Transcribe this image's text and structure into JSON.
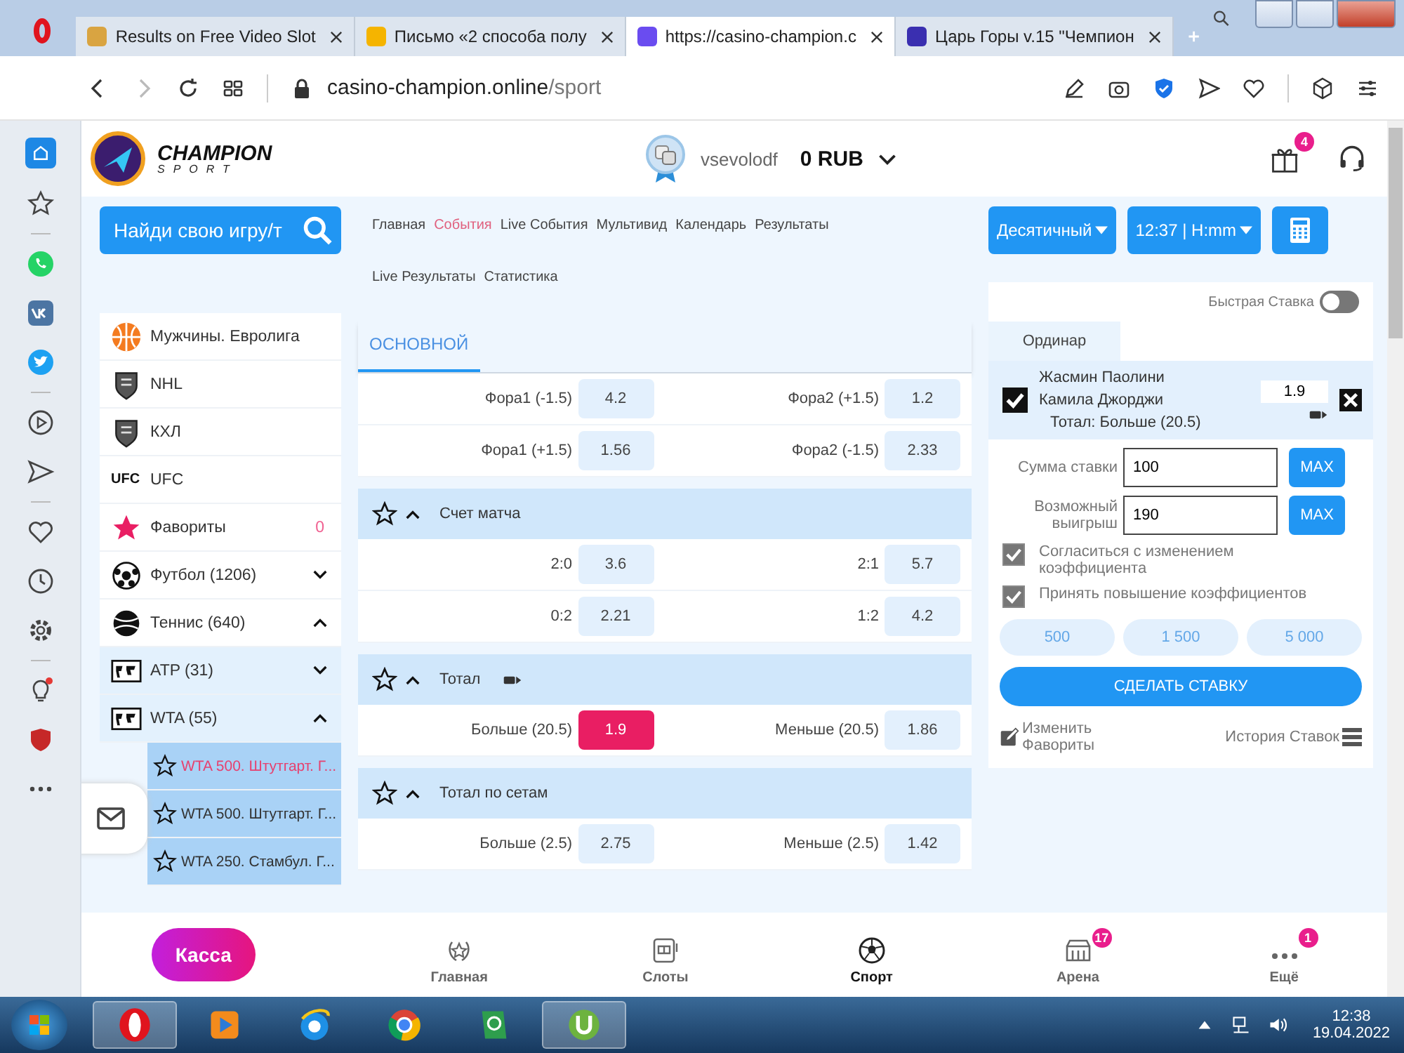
{
  "browser": {
    "tabs": [
      {
        "title": "Results on Free Video Slot",
        "selected": false
      },
      {
        "title": "Письмо «2 способа полу",
        "selected": false
      },
      {
        "title": "https://casino-champion.c",
        "selected": true
      },
      {
        "title": "Царь Горы v.15 \"Чемпион",
        "selected": false
      }
    ],
    "url": {
      "host": "casino-champion.online",
      "path": "/sport"
    }
  },
  "header": {
    "logo": {
      "title": "CHAMPION",
      "subtitle": "SPORT"
    },
    "user": {
      "name": "vsevolodf",
      "balance": "0 RUB"
    },
    "gift_badge": "4"
  },
  "search": {
    "label": "Найди свою игру/т"
  },
  "nav_links": [
    {
      "label": "Главная",
      "selected": false
    },
    {
      "label": "События",
      "selected": true
    },
    {
      "label": "Live События",
      "selected": false
    },
    {
      "label": "Мультивид",
      "selected": false
    },
    {
      "label": "Календарь",
      "selected": false
    },
    {
      "label": "Результаты",
      "selected": false
    },
    {
      "label": "Live Результаты",
      "selected": false
    },
    {
      "label": "Статистика",
      "selected": false
    }
  ],
  "settings": {
    "odds_format": "Десятичный",
    "time_format": "12:37 | H:mm"
  },
  "sidebar": {
    "items": [
      {
        "label": "Мужчины. Евролига",
        "kind": "basketball",
        "selected": false
      },
      {
        "label": "NHL",
        "kind": "shield",
        "selected": false
      },
      {
        "label": "КХЛ",
        "kind": "shield",
        "selected": false
      },
      {
        "label": "UFC",
        "kind": "text_logo",
        "logo_text": "UFC",
        "selected": false
      },
      {
        "label": "Фавориты",
        "kind": "favorites",
        "count": "0",
        "selected": false
      },
      {
        "label": "Футбол (1206)",
        "kind": "football",
        "expanded": false,
        "selected": false
      },
      {
        "label": "Теннис (640)",
        "kind": "tennis",
        "expanded": true,
        "selected": false,
        "children": [
          {
            "label": "ATP (31)",
            "kind": "map",
            "expanded": false,
            "selected": false
          },
          {
            "label": "WTA (55)",
            "kind": "map",
            "expanded": true,
            "selected": false,
            "children": [
              {
                "label": "WTA 500. Штутгарт. Г...",
                "kind": "star",
                "selected": true
              },
              {
                "label": "WTA 500. Штутгарт. Г...",
                "kind": "star",
                "selected": false
              },
              {
                "label": "WTA 250. Стамбул. Г...",
                "kind": "star",
                "selected": false
              }
            ]
          }
        ]
      }
    ]
  },
  "market_tabs": [
    {
      "label": "ОСНОВНОЙ",
      "selected": true
    }
  ],
  "markets": [
    {
      "rows": [
        {
          "outcomes": [
            {
              "label": "Фора1 (-1.5)",
              "odds": "4.2",
              "selected": false
            },
            {
              "label": "Фора2 (+1.5)",
              "odds": "1.2",
              "selected": false
            }
          ]
        },
        {
          "outcomes": [
            {
              "label": "Фора1 (+1.5)",
              "odds": "1.56",
              "selected": false
            },
            {
              "label": "Фора2 (-1.5)",
              "odds": "2.33",
              "selected": false
            }
          ]
        }
      ]
    },
    {
      "title": "Счет матча",
      "favorite": false,
      "expanded": true,
      "cashout": false,
      "rows": [
        {
          "outcomes": [
            {
              "label": "2:0",
              "odds": "3.6",
              "selected": false
            },
            {
              "label": "2:1",
              "odds": "5.7",
              "selected": false
            }
          ]
        },
        {
          "outcomes": [
            {
              "label": "0:2",
              "odds": "2.21",
              "selected": false
            },
            {
              "label": "1:2",
              "odds": "4.2",
              "selected": false
            }
          ]
        }
      ]
    },
    {
      "title": "Тотал",
      "favorite": false,
      "expanded": true,
      "cashout": true,
      "rows": [
        {
          "outcomes": [
            {
              "label": "Больше (20.5)",
              "odds": "1.9",
              "selected": true
            },
            {
              "label": "Меньше (20.5)",
              "odds": "1.86",
              "selected": false
            }
          ]
        }
      ]
    },
    {
      "title": "Тотал по сетам",
      "favorite": false,
      "expanded": true,
      "cashout": false,
      "rows": [
        {
          "outcomes": [
            {
              "label": "Больше (2.5)",
              "odds": "2.75",
              "selected": false
            },
            {
              "label": "Меньше (2.5)",
              "odds": "1.42",
              "selected": false
            }
          ]
        }
      ]
    }
  ],
  "bet_slip": {
    "quick_bet": {
      "label": "Быстрая Ставка",
      "on": false
    },
    "tabs": [
      {
        "label": "Ординар",
        "selected": true
      }
    ],
    "bet": {
      "team1": "Жасмин Паолини",
      "team2": "Камила Джорджи",
      "market": "Тотал: Больше (20.5)",
      "odds": "1.9",
      "checked": true
    },
    "stake": {
      "label": "Сумма ставки",
      "value": "100",
      "button": "MAX"
    },
    "payout": {
      "label": "Возможный выигрыш",
      "value": "190",
      "button": "MAX"
    },
    "options": [
      {
        "label": "Согласиться с изменением коэффициента",
        "checked": true
      },
      {
        "label": "Принять повышение коэффициентов",
        "checked": true
      }
    ],
    "amounts": [
      "500",
      "1 500",
      "5 000"
    ],
    "submit": "СДЕЛАТЬ СТАВКУ",
    "edit_favorites": "Изменить Фавориты",
    "history": "История Ставок"
  },
  "bottom_nav": {
    "cashier": "Касса",
    "items": [
      {
        "label": "Главная",
        "kind": "laurel",
        "selected": false
      },
      {
        "label": "Слоты",
        "kind": "slot",
        "selected": false
      },
      {
        "label": "Спорт",
        "kind": "ball",
        "selected": true
      },
      {
        "label": "Арена",
        "kind": "arena",
        "selected": false,
        "badge": "17"
      },
      {
        "label": "Ещё",
        "kind": "dots",
        "selected": false,
        "badge": "1"
      }
    ]
  },
  "taskbar": {
    "apps": [
      {
        "kind": "opera",
        "selected": true
      },
      {
        "kind": "media",
        "selected": false
      },
      {
        "kind": "ie",
        "selected": false
      },
      {
        "kind": "chrome",
        "selected": false
      },
      {
        "kind": "notes",
        "selected": false
      },
      {
        "kind": "torrent",
        "selected": true
      }
    ],
    "time": "12:38",
    "date": "19.04.2022"
  }
}
